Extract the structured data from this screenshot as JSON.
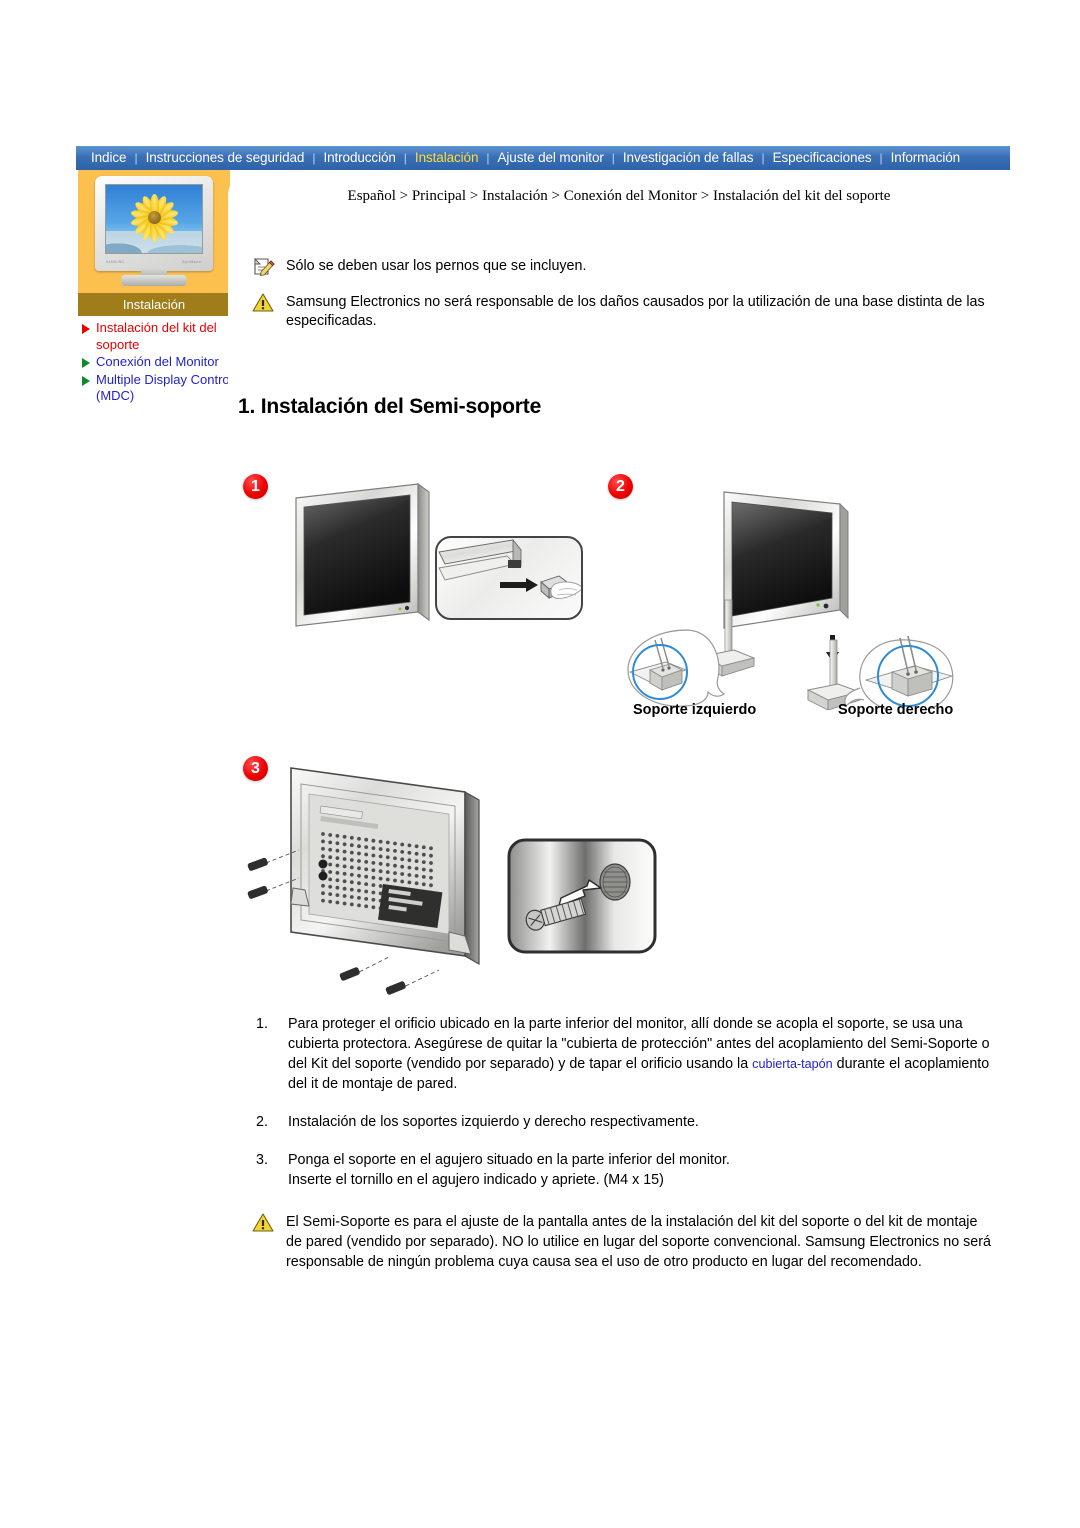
{
  "nav": {
    "items": [
      {
        "label": "Indice",
        "active": false
      },
      {
        "label": "Instrucciones de seguridad",
        "active": false
      },
      {
        "label": "Introducción",
        "active": false
      },
      {
        "label": "Instalación",
        "active": true
      },
      {
        "label": "Ajuste del monitor",
        "active": false
      },
      {
        "label": "Investigación de fallas",
        "active": false
      },
      {
        "label": "Especificaciones",
        "active": false
      },
      {
        "label": "Información",
        "active": false
      }
    ],
    "separator": "|",
    "colors": {
      "bar": "#3a6fb5",
      "active_text": "#ffdd33",
      "text": "#ffffff"
    }
  },
  "sidebar": {
    "section_title": "Instalación",
    "links": [
      {
        "label": "Instalación del kit del soporte",
        "current": true
      },
      {
        "label": "Conexión del Monitor",
        "current": false
      },
      {
        "label": "Multiple Display Control (MDC)",
        "current": false
      }
    ],
    "colors": {
      "panel": "#fcc04e",
      "title_bar": "#a07c1b",
      "current": "#e40000",
      "link": "#2222cc"
    }
  },
  "breadcrumb": "Español > Principal > Instalación > Conexión del Monitor > Instalación del kit del soporte",
  "notices": [
    {
      "icon": "note-icon",
      "text": "Sólo se deben usar los pernos que se incluyen."
    },
    {
      "icon": "warning-icon",
      "text": "Samsung Electronics no será responsable de los daños causados por la utilización de una base distinta de las especificadas."
    }
  ],
  "section_heading": "1. Instalación del Semi-soporte",
  "figures": {
    "step1": {
      "badge": "1"
    },
    "step2": {
      "badge": "2",
      "label_left": "Soporte izquierdo",
      "label_right": "Soporte derecho"
    },
    "step3": {
      "badge": "3"
    }
  },
  "steps": [
    {
      "num": "1.",
      "text_before": "Para proteger el orificio ubicado en la parte inferior del monitor, allí donde se acopla el soporte, se usa una cubierta protectora. Asegúrese de quitar la \"cubierta de protección\" antes del acoplamiento del Semi-Soporte o del Kit del soporte (vendido por separado) y de tapar el orificio usando la ",
      "link": "cubierta-tapón",
      "text_after": " durante el acoplamiento del it de montaje de pared."
    },
    {
      "num": "2.",
      "text_before": "Instalación de los soportes izquierdo y derecho respectivamente.",
      "link": "",
      "text_after": ""
    },
    {
      "num": "3.",
      "text_before": "Ponga el soporte en el agujero situado en la parte inferior del monitor.\nInserte el tornillo en el agujero indicado y apriete. (M4 x 15)",
      "link": "",
      "text_after": ""
    }
  ],
  "final_warning": {
    "icon": "warning-icon",
    "text": "El Semi-Soporte es para el ajuste de la pantalla antes de la instalación del kit del soporte o del kit de montaje de pared (vendido por separado).  NO lo utilice en lugar del soporte convencional.  Samsung Electronics no será responsable de ningún problema cuya causa sea el uso de otro producto en lugar del recomendado."
  }
}
